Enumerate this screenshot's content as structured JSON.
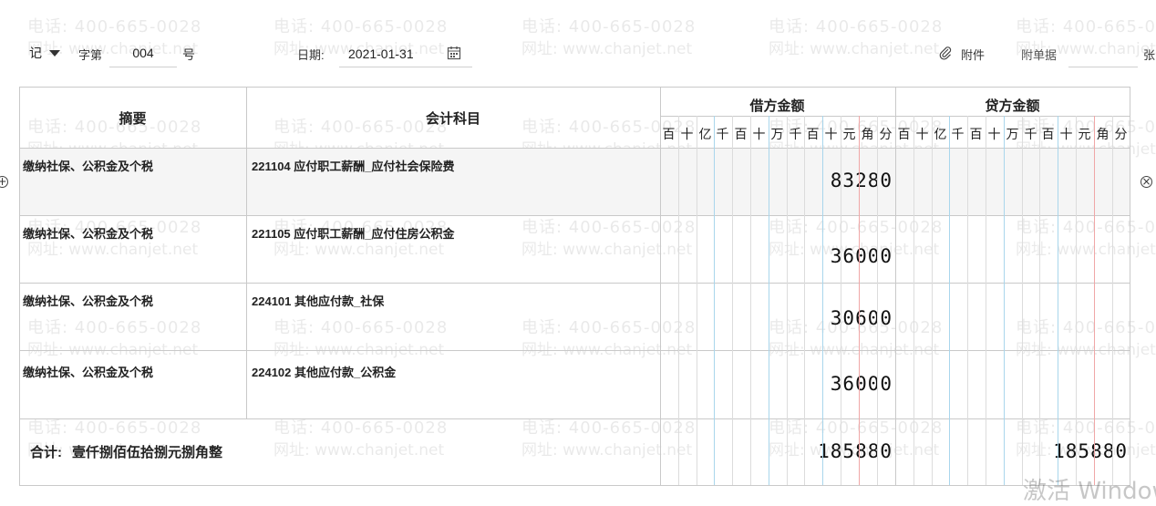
{
  "watermark": {
    "phone": "电话: 400-665-0028",
    "url": "网址: www.chanjet.net"
  },
  "header": {
    "voucher_word": "记",
    "zi_label": "字第",
    "number": "004",
    "hao_label": "号",
    "date_label": "日期:",
    "date": "2021-01-31",
    "attachment_label": "附件",
    "attach_docs_label": "附单据",
    "attach_docs_value": "",
    "zhang_label": "张"
  },
  "columns": {
    "summary": "摘要",
    "account": "会计科目",
    "debit": "借方金额",
    "credit": "贷方金额",
    "units": [
      "百",
      "十",
      "亿",
      "千",
      "百",
      "十",
      "万",
      "千",
      "百",
      "十",
      "元",
      "角",
      "分"
    ]
  },
  "rows": [
    {
      "summary": "缴纳社保、公积金及个税",
      "account": "221104 应付职工薪酬_应付社会保险费",
      "debit": "83280",
      "credit": ""
    },
    {
      "summary": "缴纳社保、公积金及个税",
      "account": "221105 应付职工薪酬_应付住房公积金",
      "debit": "36000",
      "credit": ""
    },
    {
      "summary": "缴纳社保、公积金及个税",
      "account": "224101 其他应付款_社保",
      "debit": "30600",
      "credit": ""
    },
    {
      "summary": "缴纳社保、公积金及个税",
      "account": "224102 其他应付款_公积金",
      "debit": "36000",
      "credit": ""
    }
  ],
  "total": {
    "label": "合计:",
    "amount_words": "壹仟捌佰伍拾捌元捌角整",
    "debit": "185880",
    "credit": "185880"
  },
  "controls": {
    "add_row_icon": "plus-circle-icon",
    "delete_row_icon": "close-circle-icon"
  },
  "os_overlay": {
    "text": "激活 Windows"
  }
}
